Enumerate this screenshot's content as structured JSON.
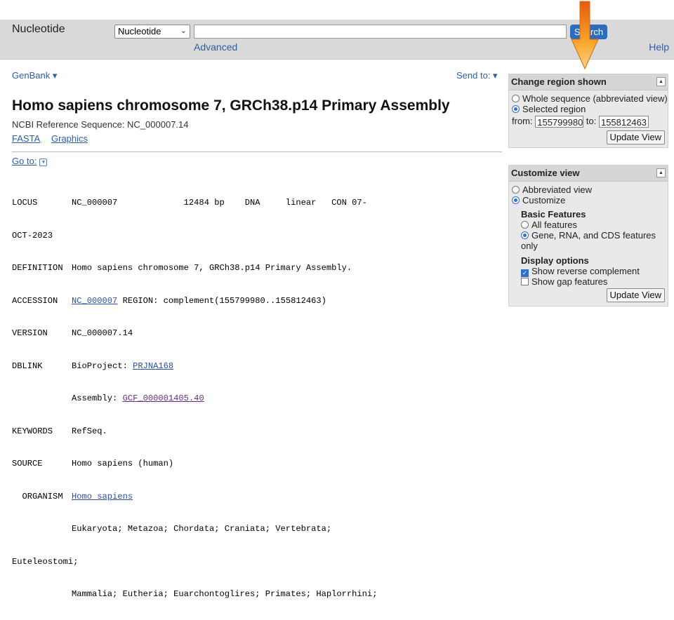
{
  "header": {
    "app_title": "Nucleotide",
    "db_select_value": "Nucleotide",
    "search_value": "",
    "search_button": "Search",
    "advanced_link": "Advanced",
    "help_link": "Help"
  },
  "main": {
    "format_menu": "GenBank",
    "send_to_menu": "Send to:",
    "title": "Homo sapiens chromosome 7, GRCh38.p14 Primary Assembly",
    "refseq_line": "NCBI Reference Sequence: NC_000007.14",
    "links": {
      "fasta": "FASTA",
      "graphics": "Graphics"
    },
    "goto": "Go to:",
    "flatfile": {
      "locus_key": "LOCUS",
      "locus_value": "NC_000007             12484 bp    DNA     linear   CON 07-",
      "locus_cont": "OCT-2023",
      "definition_key": "DEFINITION",
      "definition_value": "Homo sapiens chromosome 7, GRCh38.p14 Primary Assembly.",
      "accession_key": "ACCESSION",
      "accession_link": "NC_000007",
      "accession_rest": " REGION: complement(155799980..155812463)",
      "version_key": "VERSION",
      "version_value": "NC_000007.14",
      "dblink_key": "DBLINK",
      "dblink_bioproject_label": "BioProject: ",
      "dblink_bioproject_link": "PRJNA168",
      "dblink_assembly_label": "Assembly: ",
      "dblink_assembly_link": "GCF_000001405.40",
      "keywords_key": "KEYWORDS",
      "keywords_value": "RefSeq.",
      "source_key": "SOURCE",
      "source_value": "Homo sapiens (human)",
      "organism_key": "  ORGANISM",
      "organism_link": "Homo sapiens",
      "lineage_1": "Eukaryota; Metazoa; Chordata; Craniata; Vertebrata;",
      "lineage_2_prefix": "Euteleostomi;",
      "lineage_3": "Mammalia; Eutheria; Euarchontoglires; Primates; Haplorrhini;"
    }
  },
  "region_panel": {
    "title": "Change region shown",
    "opt_whole": "Whole sequence (abbreviated view)",
    "opt_selected": "Selected region",
    "from_label": "from:",
    "from_value": "155799980",
    "to_label": "to:",
    "to_value": "155812463",
    "update_button": "Update View"
  },
  "customize_panel": {
    "title": "Customize view",
    "opt_abbreviated": "Abbreviated view",
    "opt_customize": "Customize",
    "basic_features_heading": "Basic Features",
    "opt_all_features": "All features",
    "opt_gene_rna_cds_1": "Gene, RNA, and CDS features",
    "opt_gene_rna_cds_2": "only",
    "display_options_heading": "Display options",
    "chk_reverse": "Show reverse complement",
    "chk_gap": "Show gap features",
    "update_button": "Update View"
  },
  "colors": {
    "link": "#2b5fa8",
    "accent_arrow": "#f39c12",
    "search_button_bg": "#2d6bbd",
    "topbar_bg": "#d9d9d9",
    "panel_bg": "#e9e9e9"
  }
}
